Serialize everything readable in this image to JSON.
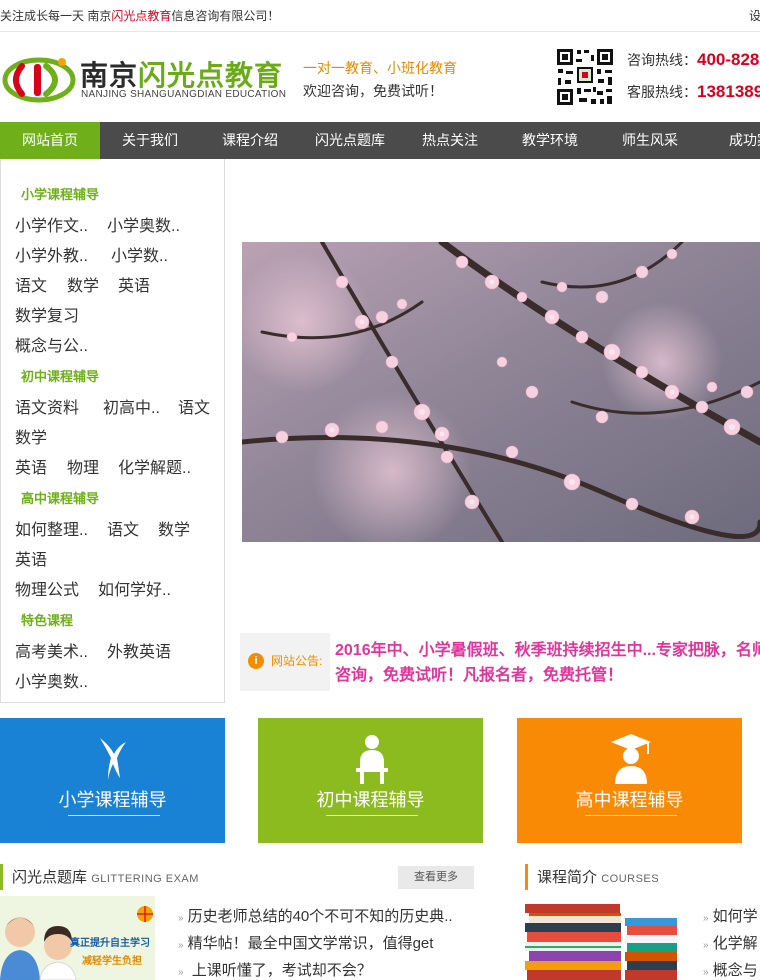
{
  "topbar": {
    "slogan_prefix": "关注成长每一天 南京",
    "slogan_brand": "闪光点教育",
    "slogan_suffix": "信息咨询有限公司！",
    "right_link": "设"
  },
  "header": {
    "title_dark": "南京",
    "title_green": "闪光点教育",
    "subtitle": "NANJING SHANGUANGDIAN EDUCATION",
    "tagline1": "一对一教育、小班化教育",
    "tagline2": "欢迎咨询，免费试听！",
    "hotline1_label": "咨询热线：",
    "hotline1_num": "400-828",
    "hotline2_label": "客服热线：",
    "hotline2_num": "1381389"
  },
  "nav": {
    "items": [
      "网站首页",
      "关于我们",
      "课程介绍",
      "闪光点题库",
      "热点关注",
      "教学环境",
      "师生风采",
      "成功案"
    ]
  },
  "sidebar": {
    "cat1": "小学课程辅导",
    "cat1_links": [
      "小学作文..",
      "小学奥数..",
      "小学外教..",
      "小学数..",
      "语文",
      "数学",
      "英语",
      "数学复习",
      "概念与公.."
    ],
    "cat2": "初中课程辅导",
    "cat2_links": [
      "语文资料",
      "初高中..",
      "语文",
      "数学",
      "英语",
      "物理",
      "化学解题.."
    ],
    "cat3": "高中课程辅导",
    "cat3_links": [
      "如何整理..",
      "语文",
      "数学",
      "英语",
      "物理公式",
      "如何学好.."
    ],
    "cat4": "特色课程",
    "cat4_links": [
      "高考美术..",
      "外教英语",
      "小学奥数.."
    ]
  },
  "notice": {
    "label": "网站公告:",
    "line1": "2016年中、小学暑假班、秋季班持续招生中...专家把脉，名师",
    "line2": "咨询，免费试听！凡报名者，免费托管！"
  },
  "tiles": {
    "primary": "小学课程辅导",
    "middle": "初中课程辅导",
    "high": "高中课程辅导",
    "colors": {
      "primary": "#1a82d4",
      "middle": "#8bbb1e",
      "high": "#f88a05"
    }
  },
  "exam": {
    "title": "闪光点题库",
    "title_en": "GLITTERING EXAM",
    "more": "查看更多",
    "img_text1": "真正提升自主学习",
    "img_text2": "减轻学生负担",
    "items": [
      "历史老师总结的40个不可不知的历史典..",
      "精华帖！最全中国文学常识，值得get",
      "上课听懂了，考试却不会？"
    ]
  },
  "courses": {
    "title": "课程简介",
    "title_en": "COURSES",
    "items": [
      "如何学",
      "化学解",
      "概念与"
    ]
  },
  "colors": {
    "accent_green": "#6fb01a",
    "nav_bg": "#4b4b4b",
    "hot_red": "#d9001b",
    "notice_pink": "#e0359c",
    "notice_orange": "#f28c00"
  }
}
